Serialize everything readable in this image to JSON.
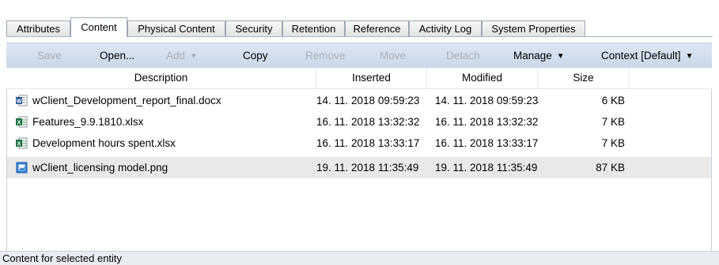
{
  "tabs": [
    {
      "label": "Attributes",
      "active": false
    },
    {
      "label": "Content",
      "active": true
    },
    {
      "label": "Physical Content",
      "active": false
    },
    {
      "label": "Security",
      "active": false
    },
    {
      "label": "Retention",
      "active": false
    },
    {
      "label": "Reference",
      "active": false
    },
    {
      "label": "Activity Log",
      "active": false
    },
    {
      "label": "System Properties",
      "active": false
    }
  ],
  "toolbar": {
    "save": "Save",
    "open": "Open...",
    "add": "Add",
    "copy": "Copy",
    "remove": "Remove",
    "move": "Move",
    "detach": "Detach",
    "manage": "Manage",
    "context": "Context [Default]"
  },
  "columns": {
    "description": "Description",
    "inserted": "Inserted",
    "modified": "Modified",
    "size": "Size"
  },
  "rows": [
    {
      "icon": "word-document-icon",
      "name": "wClient_Development_report_final.docx",
      "inserted": "14. 11. 2018 09:59:23",
      "modified": "14. 11. 2018 09:59:23",
      "size": "6 KB",
      "selected": false
    },
    {
      "icon": "excel-spreadsheet-icon",
      "name": "Features_9.9.1810.xlsx",
      "inserted": "16. 11. 2018 13:32:32",
      "modified": "16. 11. 2018 13:32:32",
      "size": "7 KB",
      "selected": false
    },
    {
      "icon": "excel-spreadsheet-icon",
      "name": "Development hours spent.xlsx",
      "inserted": "16. 11. 2018 13:33:17",
      "modified": "16. 11. 2018 13:33:17",
      "size": "7 KB",
      "selected": false
    },
    {
      "icon": "image-file-icon",
      "name": "wClient_licensing model.png",
      "inserted": "19. 11. 2018 11:35:49",
      "modified": "19. 11. 2018 11:35:49",
      "size": "87 KB",
      "selected": true
    }
  ],
  "status": "Content for selected entity",
  "colors": {
    "toolbar": "#c9d7e8",
    "disabled_text": "#a9b0bb",
    "selected_row": "#e9e9e9",
    "word_blue": "#2b579a",
    "excel_green": "#217346"
  }
}
